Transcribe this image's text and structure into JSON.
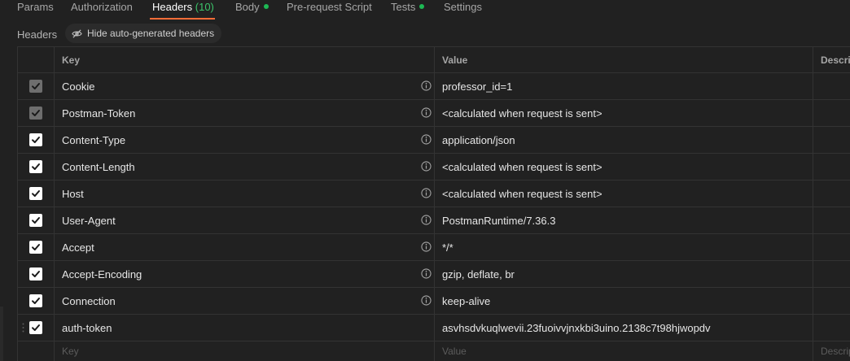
{
  "tabs": [
    {
      "label": "Params"
    },
    {
      "label": "Authorization"
    },
    {
      "label": "Headers",
      "count": "(10)"
    },
    {
      "label": "Body"
    },
    {
      "label": "Pre-request Script"
    },
    {
      "label": "Tests"
    },
    {
      "label": "Settings"
    }
  ],
  "subbar": {
    "label": "Headers",
    "hide_button": "Hide auto-generated headers"
  },
  "columns": {
    "key": "Key",
    "value": "Value",
    "description": "Description"
  },
  "rows": [
    {
      "key": "Cookie",
      "value": "professor_id=1",
      "checked": true,
      "auto": true
    },
    {
      "key": "Postman-Token",
      "value": "<calculated when request is sent>",
      "checked": true,
      "auto": true
    },
    {
      "key": "Content-Type",
      "value": "application/json",
      "checked": true,
      "auto": false
    },
    {
      "key": "Content-Length",
      "value": "<calculated when request is sent>",
      "checked": true,
      "auto": false
    },
    {
      "key": "Host",
      "value": "<calculated when request is sent>",
      "checked": true,
      "auto": false
    },
    {
      "key": "User-Agent",
      "value": "PostmanRuntime/7.36.3",
      "checked": true,
      "auto": false
    },
    {
      "key": "Accept",
      "value": "*/*",
      "checked": true,
      "auto": false
    },
    {
      "key": "Accept-Encoding",
      "value": "gzip, deflate, br",
      "checked": true,
      "auto": false
    },
    {
      "key": "Connection",
      "value": "keep-alive",
      "checked": true,
      "auto": false
    },
    {
      "key": "auth-token",
      "value": "asvhsdvkuqlwevii.23fuoivvjnxkbi3uino.2138c7t98hjwopdv",
      "checked": true,
      "auto": false
    }
  ],
  "empty_row": {
    "key_placeholder": "Key",
    "value_placeholder": "Value",
    "description_placeholder": "Description"
  },
  "colors": {
    "accent": "#ff6c37",
    "status_dot": "#1db954",
    "count": "#3cc46a",
    "background": "#212121"
  }
}
